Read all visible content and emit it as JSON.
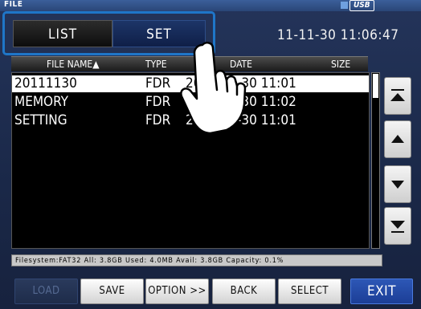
{
  "top": {
    "title": "FILE",
    "usb": "USB"
  },
  "tabs": {
    "list": "LIST",
    "set": "SET"
  },
  "datetime": "11-11-30 11:06:47",
  "headers": {
    "name": "FILE NAME▲",
    "type": "TYPE",
    "date": "DATE",
    "size": "SIZE"
  },
  "rows": [
    {
      "name": "20111130",
      "type": "FDR",
      "date": "2011-11-30 11:01"
    },
    {
      "name": "MEMORY",
      "type": "FDR",
      "date": "2011-11-30 11:02"
    },
    {
      "name": "SETTING",
      "type": "FDR",
      "date": "2011-11-30 11:01"
    }
  ],
  "status": "Filesystem:FAT32 All: 3.8GB Used: 4.0MB Avail: 3.8GB Capacity: 0.1%",
  "buttons": {
    "load": "LOAD",
    "save": "SAVE",
    "option": "OPTION >>",
    "back": "BACK",
    "select": "SELECT",
    "exit": "EXIT"
  },
  "scroll": {
    "top_icon": "double-up-icon",
    "up_icon": "up-icon",
    "down_icon": "down-icon",
    "bottom_icon": "double-down-icon"
  },
  "colors": {
    "accent": "#1f76c8",
    "exit": "#2d57b6",
    "background": "#1a2848"
  }
}
